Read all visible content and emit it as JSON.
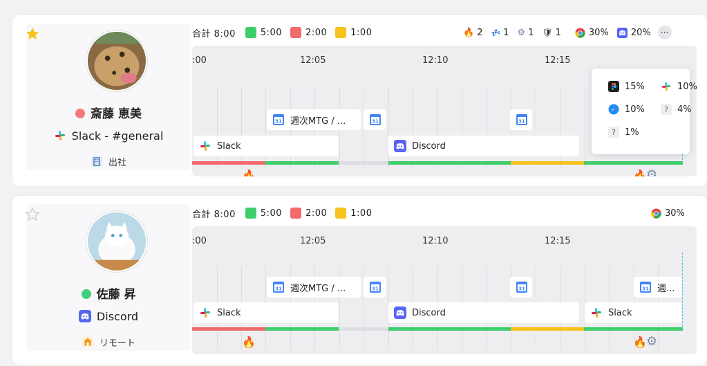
{
  "colors": {
    "green": "#3ecf6c",
    "red": "#f26b6b",
    "yellow": "#f7c21c",
    "star_gold": "#f5c518",
    "status_red": "#f47a7a",
    "status_green": "#42d07a",
    "now_line": "#3cc3e0"
  },
  "members": [
    {
      "starred": true,
      "name": "斎藤 恵美",
      "status_color": "#f47a7a",
      "app_icon": "slack-icon",
      "app_status": "Slack - #general",
      "location_icon": "office-building-icon",
      "location": "出社",
      "summary": {
        "total_label": "合計",
        "total": "8:00",
        "green": "5:00",
        "red": "2:00",
        "yellow": "1:00"
      },
      "badges": [
        {
          "icon": "fire-icon",
          "glyph": "🔥",
          "count": "2"
        },
        {
          "icon": "sleep-icon",
          "glyph": "💤",
          "count": "1"
        },
        {
          "icon": "gear-warning-icon",
          "glyph": "⚙",
          "count": "1"
        },
        {
          "icon": "shield-warning-icon",
          "glyph": "🛡",
          "count": "1"
        },
        {
          "icon": "chrome-icon",
          "count": "30%"
        },
        {
          "icon": "discord-icon",
          "count": "20%"
        }
      ],
      "time_labels": [
        ":00",
        "12:05",
        "12:10",
        "12:15"
      ],
      "calendar_blocks": [
        {
          "label": "週次MTG / ...",
          "icon": "calendar-icon"
        },
        {
          "label": "",
          "icon": "calendar-icon"
        },
        {
          "label": "",
          "icon": "calendar-icon"
        }
      ],
      "app_blocks": [
        {
          "label": "Slack",
          "icon": "slack-icon"
        },
        {
          "label": "Discord",
          "icon": "discord-icon"
        }
      ],
      "popover": [
        {
          "icon": "figma-icon",
          "value": "15%"
        },
        {
          "icon": "slack-icon",
          "value": "10%"
        },
        {
          "icon": "safari-icon",
          "value": "10%"
        },
        {
          "icon": "unknown-icon",
          "value": "4%"
        },
        {
          "icon": "unknown-icon",
          "value": "1%"
        }
      ]
    },
    {
      "starred": false,
      "name": "佐藤 昇",
      "status_color": "#42d07a",
      "app_icon": "discord-icon",
      "app_status": "Discord",
      "location_icon": "home-icon",
      "location": "リモート",
      "summary": {
        "total_label": "合計",
        "total": "8:00",
        "green": "5:00",
        "red": "2:00",
        "yellow": "1:00"
      },
      "badges": [
        {
          "icon": "chrome-icon",
          "count": "30%"
        }
      ],
      "time_labels": [
        ":00",
        "12:05",
        "12:10",
        "12:15"
      ],
      "calendar_blocks": [
        {
          "label": "週次MTG / ...",
          "icon": "calendar-icon"
        },
        {
          "label": "",
          "icon": "calendar-icon"
        },
        {
          "label": "",
          "icon": "calendar-icon"
        },
        {
          "label": "週...",
          "icon": "calendar-icon"
        }
      ],
      "app_blocks": [
        {
          "label": "Slack",
          "icon": "slack-icon"
        },
        {
          "label": "Discord",
          "icon": "discord-icon"
        },
        {
          "label": "Slack",
          "icon": "slack-icon"
        }
      ]
    }
  ]
}
